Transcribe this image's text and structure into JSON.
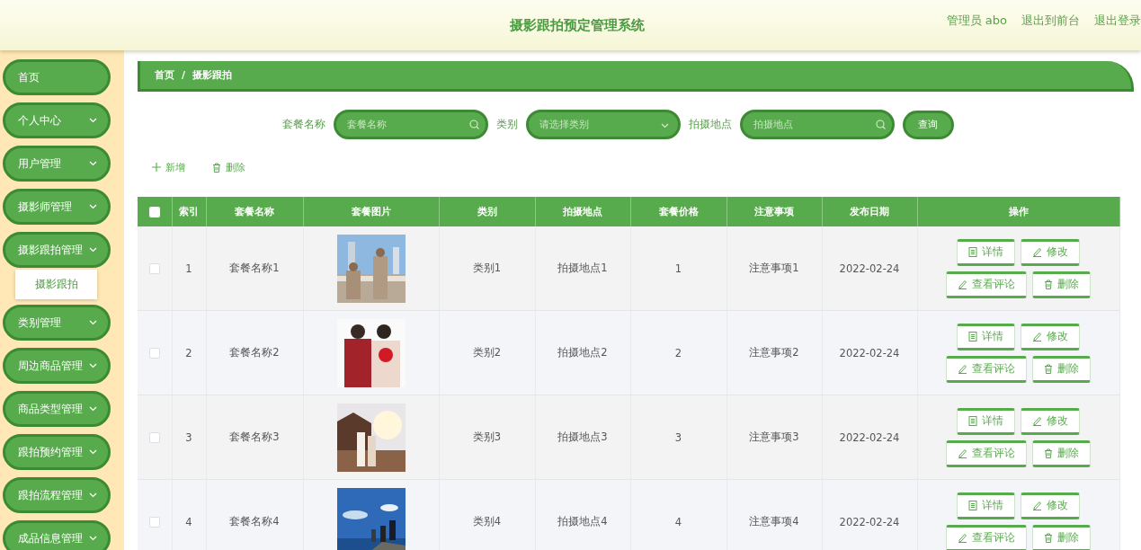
{
  "header": {
    "title": "摄影跟拍预定管理系统",
    "links": [
      "管理员 abo",
      "退出到前台",
      "退出登录"
    ]
  },
  "sidebar": {
    "items": [
      {
        "label": "首页",
        "kind": "link"
      },
      {
        "label": "个人中心",
        "kind": "menu"
      },
      {
        "label": "用户管理",
        "kind": "menu"
      },
      {
        "label": "摄影师管理",
        "kind": "menu"
      },
      {
        "label": "摄影跟拍管理",
        "kind": "menu",
        "children": [
          {
            "label": "摄影跟拍"
          }
        ]
      },
      {
        "label": "类别管理",
        "kind": "menu"
      },
      {
        "label": "周边商品管理",
        "kind": "menu"
      },
      {
        "label": "商品类型管理",
        "kind": "menu"
      },
      {
        "label": "跟拍预约管理",
        "kind": "menu"
      },
      {
        "label": "跟拍流程管理",
        "kind": "menu"
      },
      {
        "label": "成品信息管理",
        "kind": "menu"
      }
    ]
  },
  "breadcrumb": [
    "首页",
    "/",
    "摄影跟拍"
  ],
  "search": {
    "fields": [
      {
        "label": "套餐名称",
        "kind": "text",
        "placeholder": "套餐名称"
      },
      {
        "label": "类别",
        "kind": "select",
        "placeholder": "请选择类别"
      },
      {
        "label": "拍摄地点",
        "kind": "text",
        "placeholder": "拍摄地点"
      }
    ],
    "button": "查询"
  },
  "toolbar": [
    "新增",
    "删除"
  ],
  "table": {
    "select_all_checked": false,
    "columns": [
      "索引",
      "套餐名称",
      "套餐图片",
      "类别",
      "拍摄地点",
      "套餐价格",
      "注意事项",
      "发布日期",
      "操作"
    ],
    "rows": [
      {
        "checked": false,
        "cells": [
          "1",
          "套餐名称1",
          {
            "kind": "picture"
          },
          "类别1",
          "拍摄地点1",
          "1",
          "注意事项1",
          "2022-02-24"
        ],
        "actions": [
          "详情",
          "修改",
          "查看评论",
          "删除"
        ]
      },
      {
        "checked": false,
        "cells": [
          "2",
          "套餐名称2",
          {
            "kind": "picture"
          },
          "类别2",
          "拍摄地点2",
          "2",
          "注意事项2",
          "2022-02-24"
        ],
        "actions": [
          "详情",
          "修改",
          "查看评论",
          "删除"
        ]
      },
      {
        "checked": false,
        "cells": [
          "3",
          "套餐名称3",
          {
            "kind": "picture"
          },
          "类别3",
          "拍摄地点3",
          "3",
          "注意事项3",
          "2022-02-24"
        ],
        "actions": [
          "详情",
          "修改",
          "查看评论",
          "删除"
        ]
      },
      {
        "checked": false,
        "cells": [
          "4",
          "套餐名称4",
          {
            "kind": "picture"
          },
          "类别4",
          "拍摄地点4",
          "4",
          "注意事项4",
          "2022-02-24"
        ],
        "actions": [
          "详情",
          "修改",
          "查看评论",
          "删除"
        ]
      }
    ]
  }
}
